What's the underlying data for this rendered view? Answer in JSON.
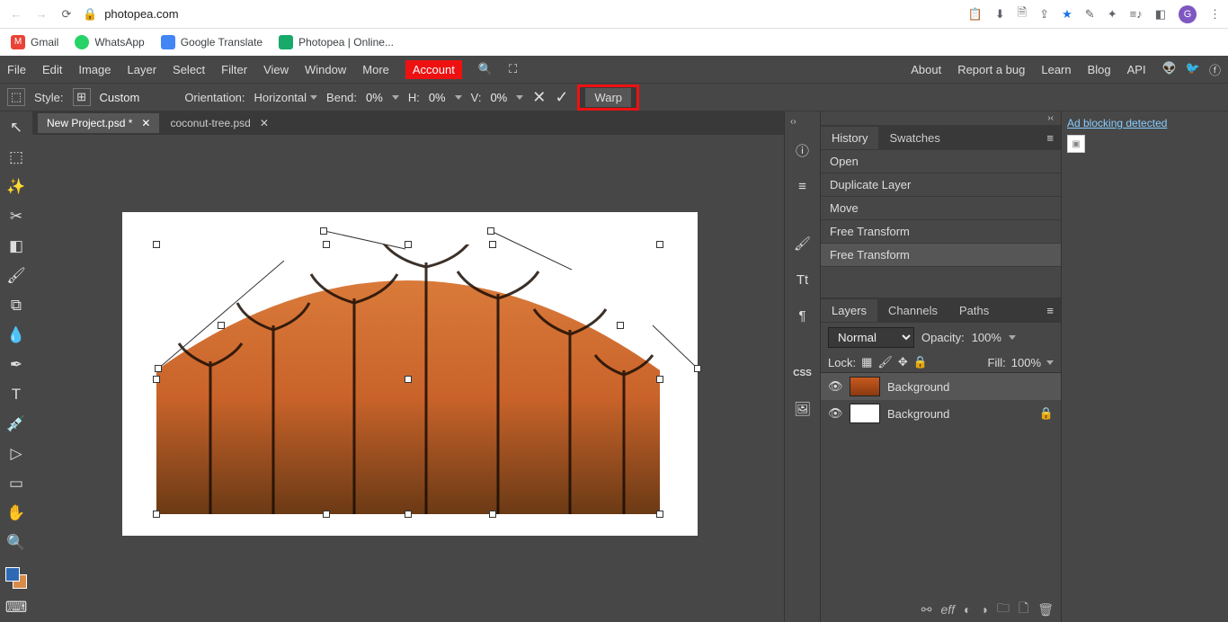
{
  "browser": {
    "url_host": "photopea.com",
    "avatar": "G"
  },
  "bookmarks": [
    {
      "label": "Gmail"
    },
    {
      "label": "WhatsApp"
    },
    {
      "label": "Google Translate"
    },
    {
      "label": "Photopea | Online..."
    }
  ],
  "menu": [
    "File",
    "Edit",
    "Image",
    "Layer",
    "Select",
    "Filter",
    "View",
    "Window",
    "More"
  ],
  "menu_account": "Account",
  "menu_right": [
    "About",
    "Report a bug",
    "Learn",
    "Blog",
    "API"
  ],
  "options": {
    "style_label": "Style:",
    "style_value": "Custom",
    "orientation_label": "Orientation:",
    "orientation_value": "Horizontal",
    "bend_label": "Bend:",
    "bend_value": "0%",
    "h_label": "H:",
    "h_value": "0%",
    "v_label": "V:",
    "v_value": "0%",
    "warp_label": "Warp"
  },
  "doc_tabs": [
    {
      "name": "New Project.psd *",
      "active": true
    },
    {
      "name": "coconut-tree.psd",
      "active": false
    }
  ],
  "panel_group1": {
    "tabs": [
      "History",
      "Swatches"
    ],
    "history": [
      "Open",
      "Duplicate Layer",
      "Move",
      "Free Transform",
      "Free Transform"
    ]
  },
  "panel_group2": {
    "tabs": [
      "Layers",
      "Channels",
      "Paths"
    ],
    "blend_mode": "Normal",
    "opacity_label": "Opacity:",
    "opacity_value": "100%",
    "lock_label": "Lock:",
    "fill_label": "Fill:",
    "fill_value": "100%",
    "layers": [
      {
        "name": "Background",
        "selected": true,
        "thumb": "img"
      },
      {
        "name": "Background",
        "selected": false,
        "locked": true,
        "thumb": "white"
      }
    ]
  },
  "ad": {
    "text": "Ad blocking detected"
  }
}
